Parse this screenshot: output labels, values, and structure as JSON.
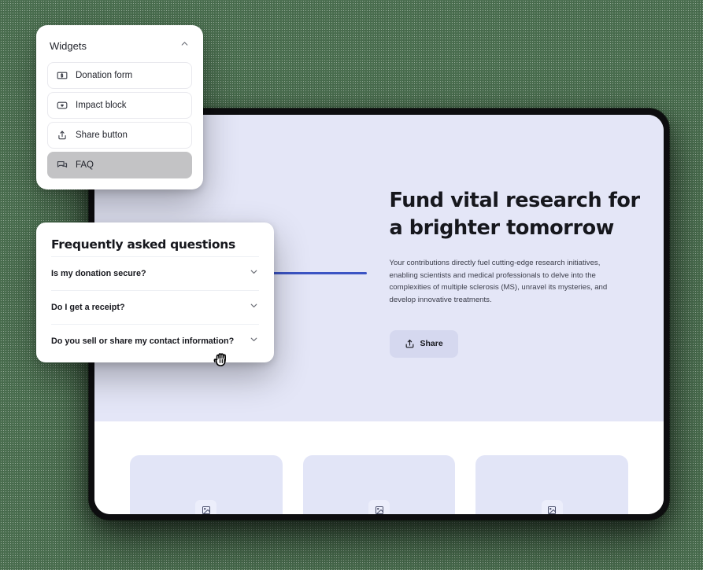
{
  "theme": {
    "background_green": "#4a6e4f",
    "device_bezel": "#0d0d0f",
    "hero_lavender": "#e4e6f7",
    "accent_blue": "#3b54c4",
    "selected_grey": "#c3c3c5",
    "share_button_bg": "#d5d8ef",
    "card_placeholder": "#e2e5f7"
  },
  "widgets_panel": {
    "title": "Widgets",
    "collapse_icon": "chevron-up-icon",
    "items": [
      {
        "label": "Donation form",
        "icon": "banknote-dollar-icon",
        "selected": false
      },
      {
        "label": "Impact block",
        "icon": "impact-block-icon",
        "selected": false
      },
      {
        "label": "Share button",
        "icon": "share-upload-icon",
        "selected": false
      },
      {
        "label": "FAQ",
        "icon": "chat-bubbles-icon",
        "selected": true
      }
    ]
  },
  "faq_panel": {
    "title": "Frequently asked questions",
    "expand_icon": "chevron-down-icon",
    "questions": [
      {
        "text": "Is my donation secure?"
      },
      {
        "text": "Do I get a receipt?"
      },
      {
        "text": "Do you sell or share my contact information?"
      }
    ]
  },
  "hero": {
    "title_line1": "Fund vital research for",
    "title_line2": "a brighter tomorrow",
    "body": "Your contributions directly fuel cutting-edge research initiatives, enabling scientists and medical professionals to delve into the complexities of multiple sclerosis (MS), unravel its mysteries, and develop innovative treatments.",
    "share_label": "Share",
    "share_icon": "share-upload-icon"
  },
  "cards": [
    {
      "icon": "image-placeholder-icon"
    },
    {
      "icon": "image-placeholder-icon"
    },
    {
      "icon": "image-placeholder-icon"
    }
  ],
  "cursor": {
    "icon": "grabbing-hand-cursor"
  }
}
